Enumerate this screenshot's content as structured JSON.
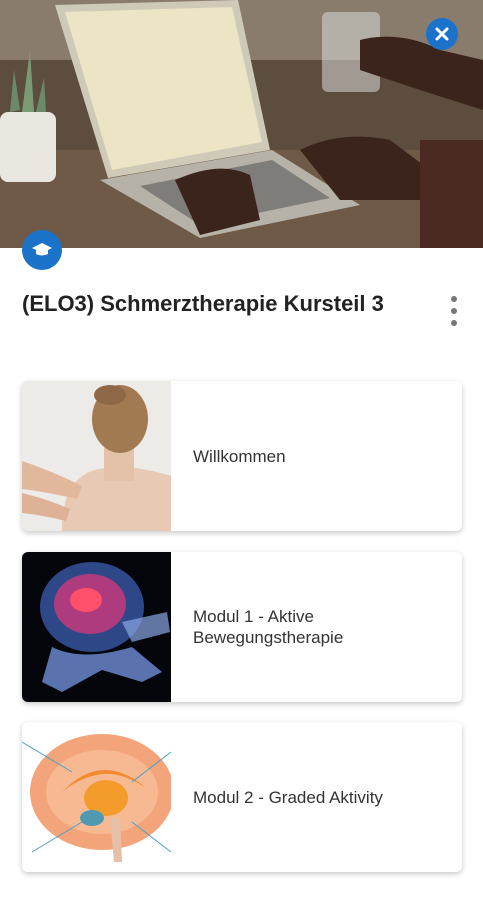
{
  "course": {
    "title": "(ELO3) Schmerztherapie Kursteil 3"
  },
  "icons": {
    "close": "close-icon",
    "course": "graduation-cap-icon",
    "menu": "more-vert-icon"
  },
  "colors": {
    "accent": "#1a73c8",
    "title": "#222222",
    "card_text": "#333333"
  },
  "modules": [
    {
      "label": "Willkommen"
    },
    {
      "label": "Modul 1 - Aktive Bewegungstherapie"
    },
    {
      "label": "Modul 2 - Graded Aktivity"
    }
  ]
}
